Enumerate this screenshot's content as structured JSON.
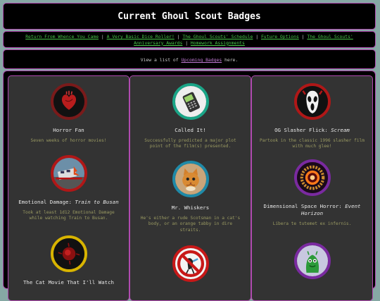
{
  "page_title": "Current Ghoul Scout Badges",
  "nav": {
    "links": [
      "Return From Whence You Came",
      "A Very Basic Dice Roller!",
      "The Ghoul Scouts' Schedule",
      "Future Options",
      "The Ghoul Scouts' Anniversary Awards",
      "Homework Assignments"
    ],
    "separator": " | "
  },
  "subheader": {
    "prefix": "View a list of ",
    "link": "Upcoming Badges",
    "suffix": " here."
  },
  "badges": [
    {
      "title": "Horror Fan",
      "desc": "Seven weeks of horror movies!",
      "icon": "anatomical-heart-icon",
      "ring": "#7a1a1a"
    },
    {
      "title": "Called It!",
      "desc": "Successfully predicted a major plot point of the film(s) presented.",
      "icon": "cell-phone-icon",
      "ring": "#1aa587"
    },
    {
      "title_prefix": "OG Slasher Flick: ",
      "title_em": "Scream",
      "desc": "Partook in the classic 1996 slasher film with much glee!",
      "icon": "ghostface-mask-icon",
      "ring": "#b01717"
    },
    {
      "title_prefix": "Emotional Damage: ",
      "title_em": "Train to Busan",
      "desc": "Took at least 1d12 Emotional Damage while watching Train to Busan.",
      "icon": "train-crash-icon",
      "ring": "#b01717"
    },
    {
      "title": "Mr. Whiskers",
      "desc": "He's either a rude Scotsman in a cat's body, or an orange tabby in dire straits.",
      "icon": "orange-cat-icon",
      "ring": "#1f8aa8"
    },
    {
      "title_prefix": "Dimensional Space Horror: ",
      "title_em": "Event Horizon",
      "desc": "Libera te tutemet ex infernis.",
      "icon": "portal-ring-icon",
      "ring": "#7a2aa0"
    },
    {
      "title": "The Cat Movie That I'll Watch",
      "desc": "",
      "icon": "red-blob-icon",
      "ring": "#d8b400"
    },
    {
      "title": "",
      "desc": "",
      "icon": "no-symbol-icon",
      "ring": "#c81818"
    },
    {
      "title": "",
      "desc": "",
      "icon": "green-creature-icon",
      "ring": "#7a2aa0"
    }
  ]
}
